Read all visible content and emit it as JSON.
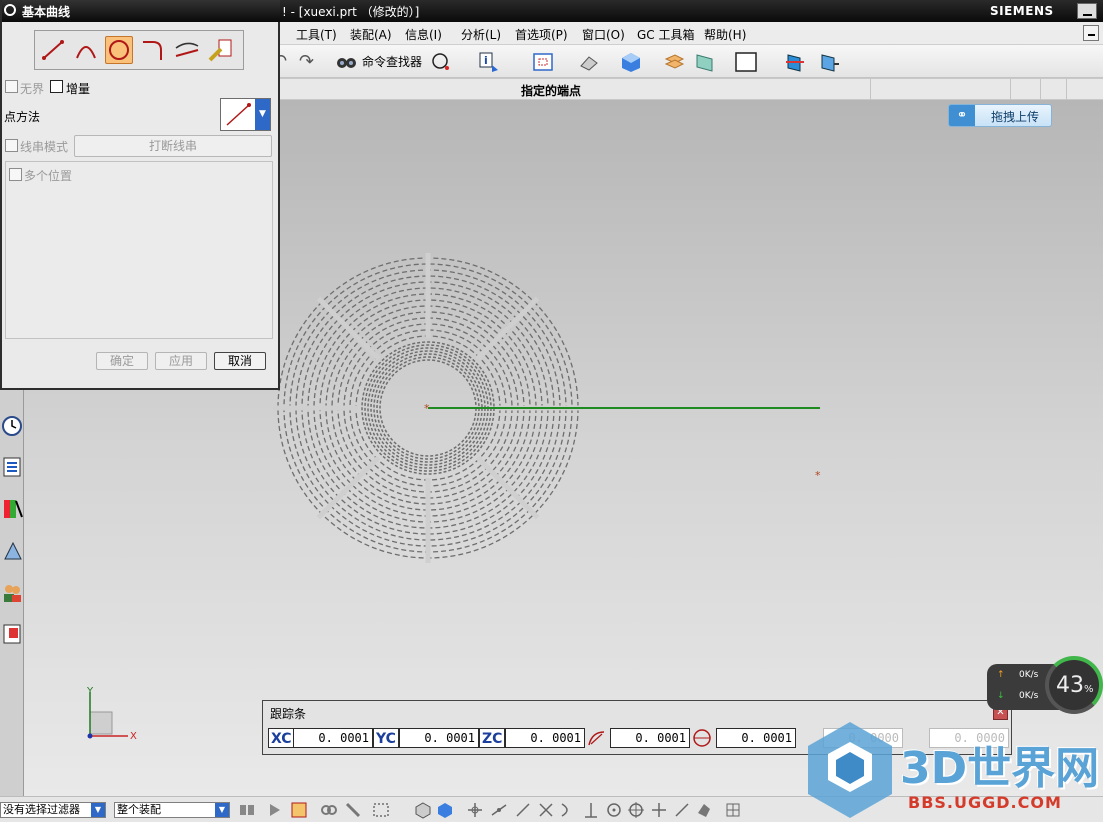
{
  "window": {
    "title": "! - [xuexi.prt （修改的）]",
    "brand": "SIEMENS"
  },
  "menu": [
    "工具(T)",
    "装配(A)",
    "信息(I)",
    "分析(L)",
    "首选项(P)",
    "窗口(O)",
    "GC 工具箱",
    "帮助(H)"
  ],
  "toolbar": {
    "command_finder": "命令查找器"
  },
  "cue_line": "指定的端点",
  "upload": {
    "label": "拖拽上传"
  },
  "dialog": {
    "title": "基本曲线",
    "tools": [
      "line-icon",
      "arc-icon",
      "circle-icon",
      "fillet-icon",
      "trim-icon",
      "edit-curve-icon"
    ],
    "active_tool": "circle-icon",
    "unbounded_label": "无界",
    "increment_label": "增量",
    "point_method_label": "点方法",
    "string_mode_label": "线串模式",
    "break_string_label": "打断线串",
    "multiple_positions_label": "多个位置",
    "ok_label": "确定",
    "apply_label": "应用",
    "cancel_label": "取消"
  },
  "tracking_bar": {
    "title": "跟踪条",
    "labels": [
      "XC",
      "YC",
      "ZC"
    ],
    "values": [
      "0. 0001",
      "0. 0001",
      "0. 0001",
      "0. 0001",
      "0. 0001",
      "0. 0000",
      "0. 0000"
    ]
  },
  "triad": {
    "x": "X",
    "y": "Y"
  },
  "net": {
    "up": "0K/s",
    "down": "0K/s",
    "percent": "43",
    "unit": "%"
  },
  "status": {
    "filter": "没有选择过滤器",
    "scope": "整个装配"
  },
  "watermark": {
    "text": "3D世界网",
    "url": "BBS.UGGD.COM"
  },
  "colors": {
    "accent": "#2f69c8",
    "line": "#1f8a1f",
    "curve": "#6e6e6e"
  }
}
